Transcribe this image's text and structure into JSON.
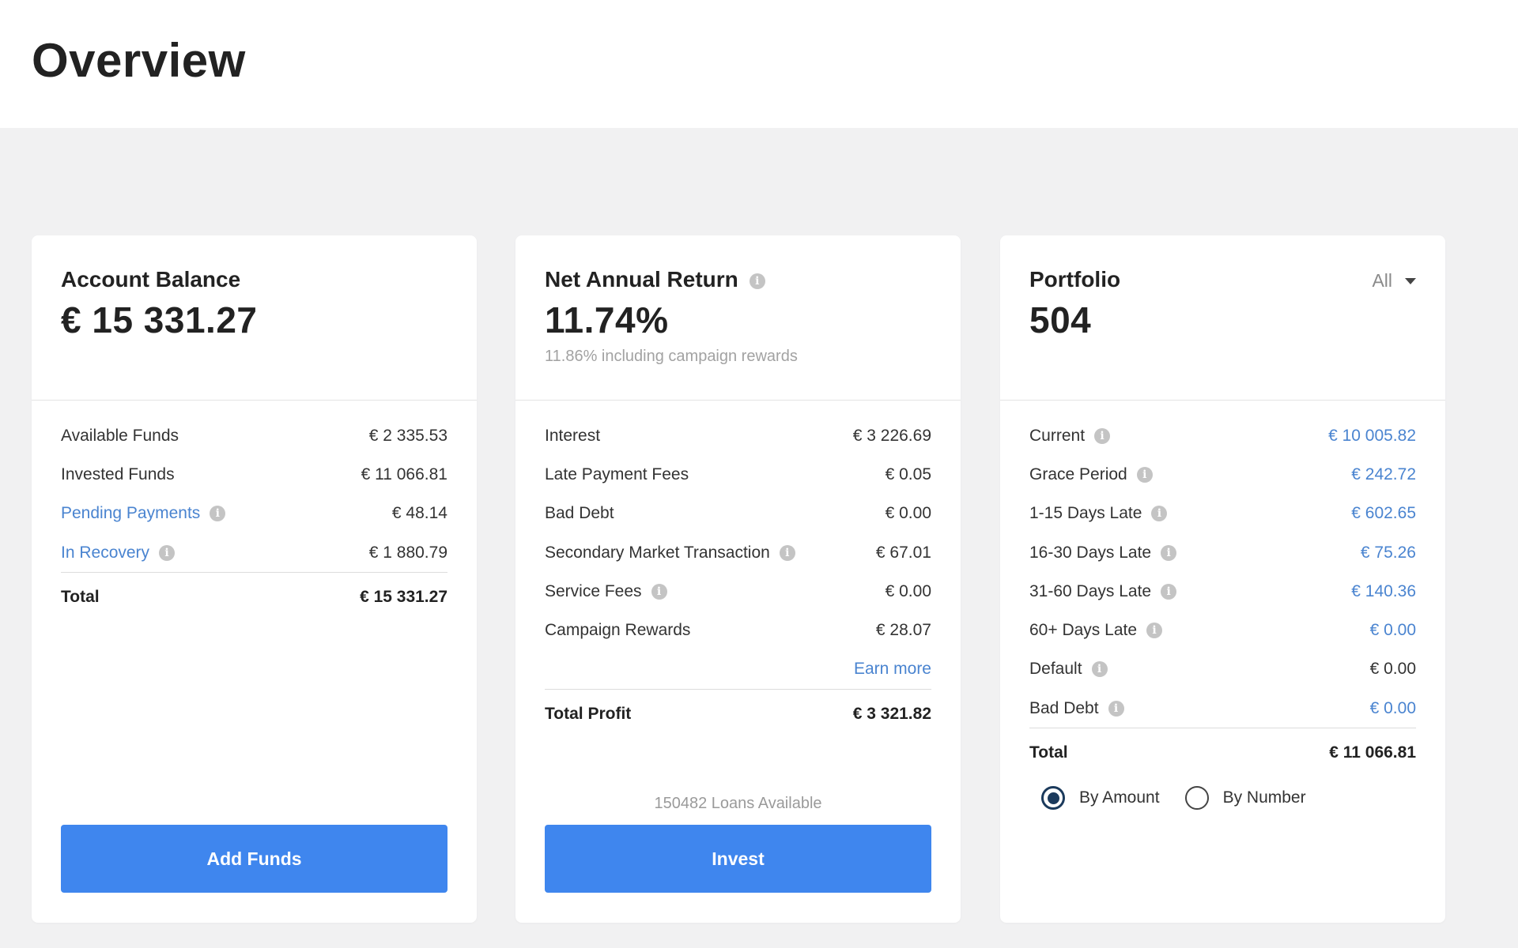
{
  "page": {
    "title": "Overview"
  },
  "account_balance": {
    "title": "Account Balance",
    "value": "€ 15 331.27",
    "rows": [
      {
        "label": "Available Funds",
        "value": "€ 2 335.53"
      },
      {
        "label": "Invested Funds",
        "value": "€ 11 066.81"
      },
      {
        "label": "Pending Payments",
        "value": "€ 48.14"
      },
      {
        "label": "In Recovery",
        "value": "€ 1 880.79"
      }
    ],
    "total_label": "Total",
    "total_value": "€ 15 331.27",
    "button_label": "Add Funds"
  },
  "net_annual_return": {
    "title": "Net Annual Return",
    "value": "11.74%",
    "subtitle": "11.86% including campaign rewards",
    "rows": [
      {
        "label": "Interest",
        "value": "€ 3 226.69"
      },
      {
        "label": "Late Payment Fees",
        "value": "€ 0.05"
      },
      {
        "label": "Bad Debt",
        "value": "€ 0.00"
      },
      {
        "label": "Secondary Market Transaction",
        "value": "€ 67.01"
      },
      {
        "label": "Service Fees",
        "value": "€ 0.00"
      },
      {
        "label": "Campaign Rewards",
        "value": "€ 28.07"
      }
    ],
    "earn_more": "Earn more",
    "total_label": "Total Profit",
    "total_value": "€ 3 321.82",
    "loans_available": "150482 Loans Available",
    "button_label": "Invest"
  },
  "portfolio": {
    "title": "Portfolio",
    "value": "504",
    "filter_value": "All",
    "rows": [
      {
        "label": "Current",
        "value": "€ 10 005.82"
      },
      {
        "label": "Grace Period",
        "value": "€ 242.72"
      },
      {
        "label": "1-15 Days Late",
        "value": "€ 602.65"
      },
      {
        "label": "16-30 Days Late",
        "value": "€ 75.26"
      },
      {
        "label": "31-60 Days Late",
        "value": "€ 140.36"
      },
      {
        "label": "60+ Days Late",
        "value": "€ 0.00"
      },
      {
        "label": "Default",
        "value": "€ 0.00"
      },
      {
        "label": "Bad Debt",
        "value": "€ 0.00"
      }
    ],
    "total_label": "Total",
    "total_value": "€ 11 066.81",
    "radio_by_amount": "By Amount",
    "radio_by_number": "By Number",
    "selected": "By Amount"
  },
  "colors": {
    "accent": "#3f86ee",
    "link": "#4a84d0",
    "background": "#f1f1f2"
  },
  "icons": {
    "info": "info-icon",
    "dropdown": "chevron-down-icon"
  }
}
